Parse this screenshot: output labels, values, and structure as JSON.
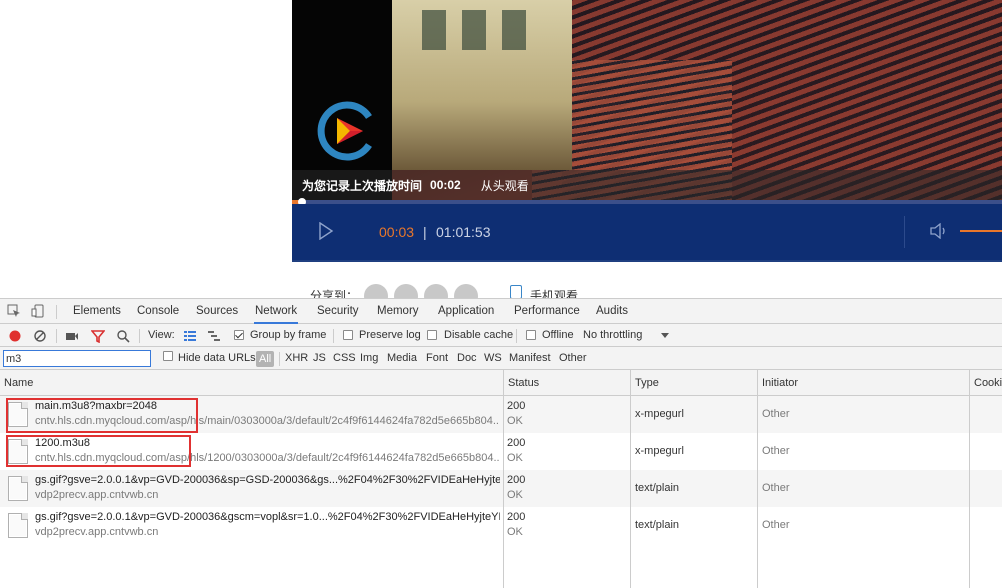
{
  "player": {
    "resume_text": "为您记录上次播放时间",
    "resume_time": "00:02",
    "resume_link": "从头观看",
    "time_current": "00:03",
    "time_separator": "|",
    "time_duration": "01:01:53",
    "progress_fraction": 0.001,
    "colors": {
      "accent": "#e9772b",
      "control_bar": "#0e2e73"
    }
  },
  "share": {
    "label": "分享到：",
    "mobile_label": "手机观看"
  },
  "devtools": {
    "tabs": [
      "Elements",
      "Console",
      "Sources",
      "Network",
      "Security",
      "Memory",
      "Application",
      "Performance",
      "Audits"
    ],
    "active_tab": "Network",
    "toolbar": {
      "view_label": "View:",
      "group_by_frame": "Group by frame",
      "preserve_log": "Preserve log",
      "disable_cache": "Disable cache",
      "offline": "Offline",
      "throttling": "No throttling"
    },
    "filter": {
      "value": "m3",
      "hide_data_urls": "Hide data URLs",
      "types": [
        "All",
        "XHR",
        "JS",
        "CSS",
        "Img",
        "Media",
        "Font",
        "Doc",
        "WS",
        "Manifest",
        "Other"
      ]
    },
    "columns": [
      "Name",
      "Status",
      "Type",
      "Initiator",
      "Cooki"
    ],
    "rows": [
      {
        "name": "main.m3u8?maxbr=2048",
        "domain": "cntv.hls.cdn.myqcloud.com/asp/hls/main/0303000a/3/default/2c4f9f6144624fa782d5e665b804...",
        "status": "200",
        "status_text": "OK",
        "type": "x-mpegurl",
        "initiator": "Other",
        "highlighted": true
      },
      {
        "name": "1200.m3u8",
        "domain": "cntv.hls.cdn.myqcloud.com/asp/hls/1200/0303000a/3/default/2c4f9f6144624fa782d5e665b804...",
        "status": "200",
        "status_text": "OK",
        "type": "x-mpegurl",
        "initiator": "Other",
        "highlighted": true
      },
      {
        "name": "gs.gif?gsve=2.0.0.1&vp=GVD-200036&sp=GSD-200036&gs...%2F04%2F30%2FVIDEaHeHyjteYL...",
        "domain": "vdp2precv.app.cntvwb.cn",
        "status": "200",
        "status_text": "OK",
        "type": "text/plain",
        "initiator": "Other",
        "highlighted": false
      },
      {
        "name": "gs.gif?gsve=2.0.0.1&vp=GVD-200036&gscm=vopl&sr=1.0...%2F04%2F30%2FVIDEaHeHyjteYLE...",
        "domain": "vdp2precv.app.cntvwb.cn",
        "status": "200",
        "status_text": "OK",
        "type": "text/plain",
        "initiator": "Other",
        "highlighted": false
      }
    ],
    "icons": [
      "inspect-icon",
      "device-toolbar-icon",
      "record-icon",
      "clear-icon",
      "camera-icon",
      "filter-icon",
      "search-icon",
      "large-rows-icon",
      "waterfall-icon",
      "dropdown-icon"
    ],
    "colors": {
      "record": "#e0302e",
      "filter": "#d93030",
      "highlight_box": "#e03131",
      "active_tab": "#3879d9"
    }
  }
}
